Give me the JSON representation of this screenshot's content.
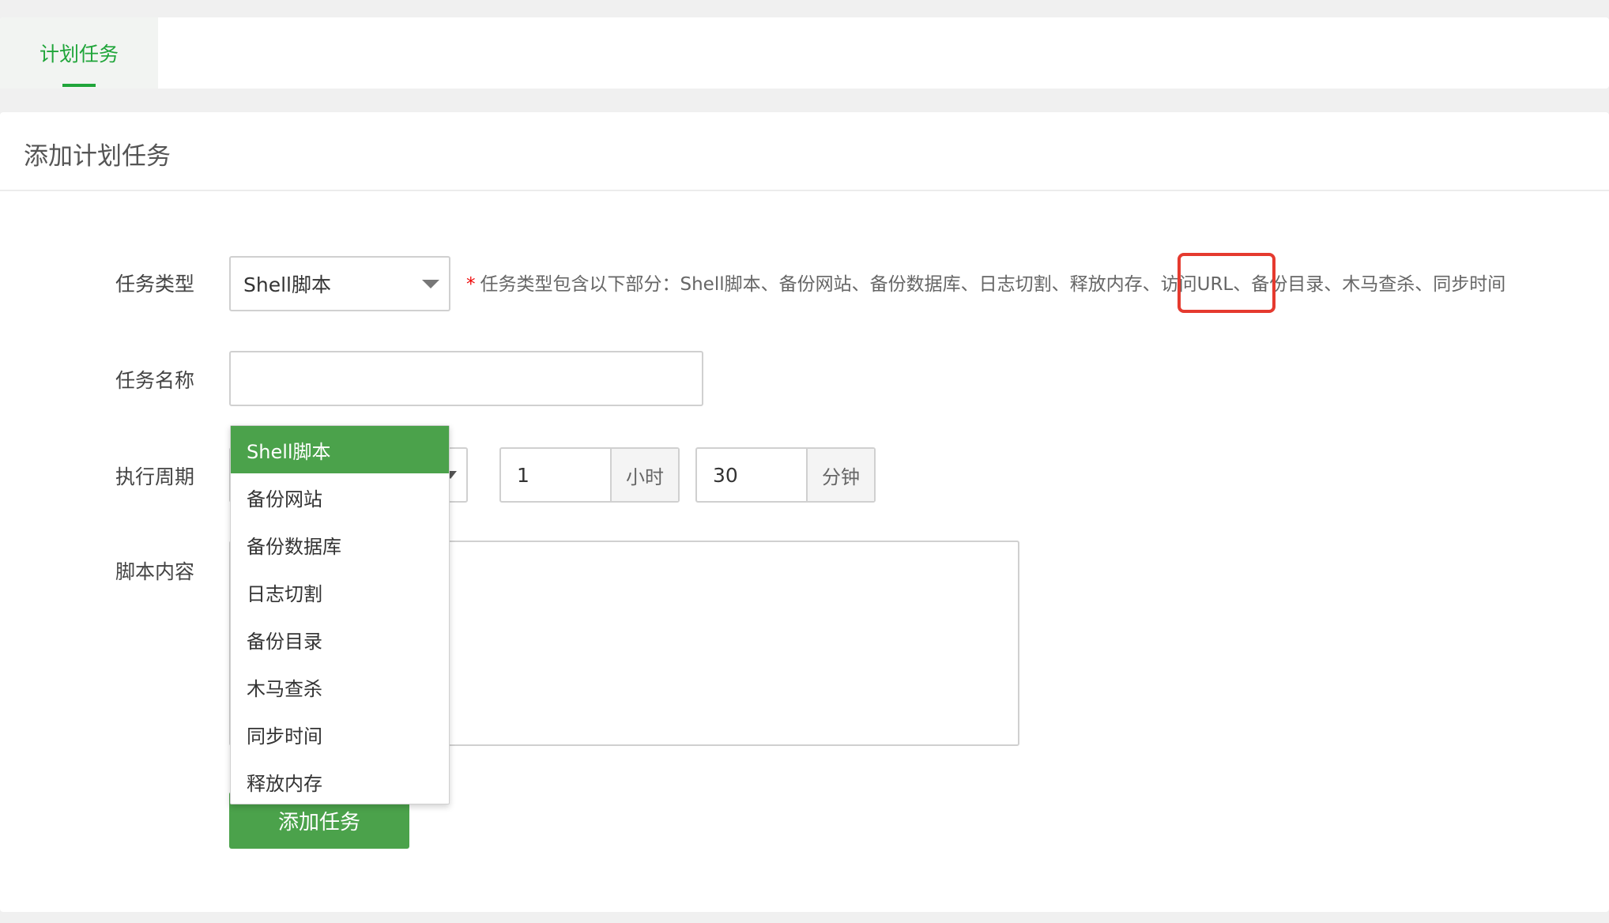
{
  "tabs": [
    {
      "label": "计划任务",
      "active": true
    }
  ],
  "panel": {
    "title": "添加计划任务"
  },
  "form": {
    "task_type": {
      "label": "任务类型",
      "value": "Shell脚本",
      "hint_marker": "*",
      "hint": "任务类型包含以下部分：Shell脚本、备份网站、备份数据库、日志切割、释放内存、访问URL、备份目录、木马查杀、同步时间",
      "highlighted_term": "访问URL",
      "options": [
        "Shell脚本",
        "备份网站",
        "备份数据库",
        "日志切割",
        "备份目录",
        "木马查杀",
        "同步时间",
        "释放内存"
      ],
      "selected_option": "Shell脚本"
    },
    "task_name": {
      "label": "任务名称",
      "value": ""
    },
    "schedule": {
      "label": "执行周期",
      "hour": {
        "value": "1",
        "unit": "小时"
      },
      "minute": {
        "value": "30",
        "unit": "分钟"
      }
    },
    "script": {
      "label": "脚本内容",
      "value": ""
    },
    "submit_label": "添加任务"
  },
  "colors": {
    "brand": "#20a53a",
    "button": "#4ba24b",
    "highlight_box": "#e53a2f",
    "required_star": "#ef0808"
  }
}
